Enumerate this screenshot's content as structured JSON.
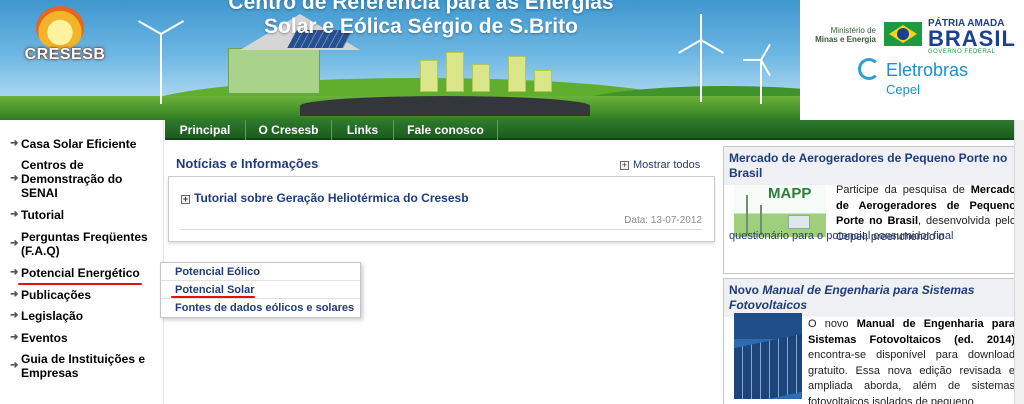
{
  "banner": {
    "title_line1": "Centro de Referência para as Energias",
    "title_line2": "Solar e Eólica Sérgio de S.Brito",
    "logo_text": "CRESESB",
    "ministry_line1": "Ministério de",
    "ministry_line2": "Minas e Energia",
    "motto_line1": "PÁTRIA AMADA",
    "motto_line2": "BRASIL",
    "motto_line3": "GOVERNO FEDERAL",
    "eletrobras_name": "Eletrobras",
    "eletrobras_sub": "Cepel"
  },
  "sidebar": {
    "items": [
      {
        "label": "Casa Solar Eficiente"
      },
      {
        "label": "Centros de Demonstração do SENAI"
      },
      {
        "label": "Tutorial"
      },
      {
        "label": "Perguntas Freqüentes (F.A.Q)"
      },
      {
        "label": "Potencial Energético"
      },
      {
        "label": "Publicações"
      },
      {
        "label": "Legislação"
      },
      {
        "label": "Eventos"
      },
      {
        "label": "Guia de Instituições e Empresas"
      }
    ]
  },
  "nav": {
    "tabs": [
      {
        "label": "Principal"
      },
      {
        "label": "O Cresesb"
      },
      {
        "label": "Links"
      },
      {
        "label": "Fale conosco"
      }
    ]
  },
  "news": {
    "title": "Notícias e Informações",
    "show_all": "Mostrar todos",
    "item_title": "Tutorial sobre Geração Heliotérmica do Cresesb",
    "item_date": "Data: 13-07-2012"
  },
  "submenu": {
    "items": [
      {
        "label": "Potencial Eólico"
      },
      {
        "label": "Potencial Solar"
      },
      {
        "label": "Fontes de dados eólicos e solares"
      }
    ]
  },
  "right": {
    "box1": {
      "title": "Mercado de Aerogeradores de Pequeno Porte no Brasil",
      "image_text": "MAPP",
      "body_pre": "Participe da pesquisa de",
      "body_bold": "Mercado de Aerogeradores de Pequeno Porte no Brasil",
      "body_mid": ", desenvolvida pelo Cepel, preenchendo o",
      "body_link": "questionário para o potencial consumidor final"
    },
    "box2": {
      "title_pre": "Novo",
      "title_italic": "Manual de Engenharia para Sistemas Fotovoltaicos",
      "body_pre": "O novo",
      "body_bold": "Manual de Engenharia para Sistemas Fotovoltaicos (ed. 2014)",
      "body_rest": "encontra-se disponível para download gratuito. Essa nova edição revisada e ampliada aborda, além de sistemas fotovoltaicos isolados de pequeno"
    }
  },
  "colors": {
    "nav_green": "#1a5b1d",
    "link_blue": "#1f3c7a",
    "highlight_red": "#e21010"
  }
}
